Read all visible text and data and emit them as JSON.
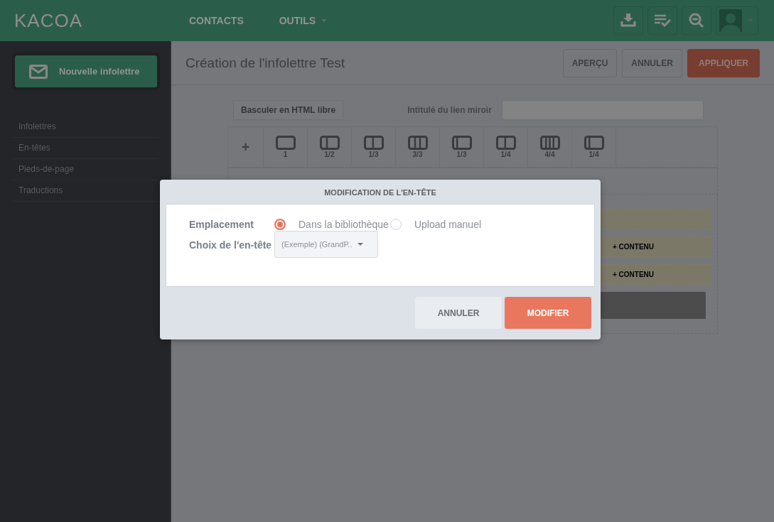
{
  "header": {
    "logo": "KACOA",
    "nav": [
      {
        "label": "CONTACTS",
        "dropdown": false
      },
      {
        "label": "OUTILS",
        "dropdown": true
      }
    ]
  },
  "sidebar": {
    "new_button": "Nouvelle infolettre",
    "items": [
      "Infolettres",
      "En-têtes",
      "Pieds-de-page",
      "Traductions"
    ]
  },
  "page": {
    "title": "Création de l'infolettre Test",
    "buttons": [
      {
        "label": "APERÇU",
        "kind": "default"
      },
      {
        "label": "ANNULER",
        "kind": "default"
      },
      {
        "label": "APPLIQUER",
        "kind": "primary"
      }
    ]
  },
  "editor": {
    "html_toggle": "Basculer en HTML libre",
    "mirror_label": "Intitulé du lien miroir",
    "add": "+",
    "layouts": [
      "1",
      "1/2",
      "1/3",
      "3/3",
      "1/3",
      "1/4",
      "4/4",
      "1/4"
    ],
    "content_rows": [
      {
        "label": ""
      },
      {
        "label": "+ CONTENU"
      },
      {
        "label": "+ CONTENU"
      }
    ]
  },
  "modal": {
    "title": "MODIFICATION DE L'EN-TÊTE",
    "location_label": "Emplacement",
    "options": [
      {
        "label": "Dans la bibliothèque",
        "selected": true
      },
      {
        "label": "Upload manuel",
        "selected": false
      }
    ],
    "choice_label": "Choix de l'en-tête",
    "choice_value": "(Exemple) (GrandP..",
    "buttons": [
      {
        "label": "ANNULER",
        "kind": "default"
      },
      {
        "label": "MODIFIER",
        "kind": "primary"
      }
    ]
  }
}
